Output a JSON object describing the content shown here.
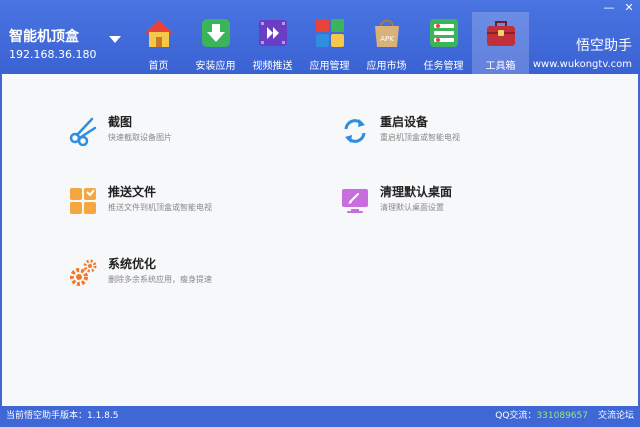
{
  "device": {
    "name": "智能机顶盒",
    "ip": "192.168.36.180"
  },
  "nav": [
    {
      "label": "首页",
      "icon": "home-icon"
    },
    {
      "label": "安装应用",
      "icon": "install-app-icon"
    },
    {
      "label": "视频推送",
      "icon": "video-push-icon"
    },
    {
      "label": "应用管理",
      "icon": "app-manage-icon"
    },
    {
      "label": "应用市场",
      "icon": "apk-market-icon"
    },
    {
      "label": "任务管理",
      "icon": "task-manage-icon"
    },
    {
      "label": "工具箱",
      "icon": "toolbox-icon",
      "active": true
    }
  ],
  "brand": {
    "name": "悟空助手",
    "url": "www.wukongtv.com"
  },
  "tools": [
    {
      "title": "截图",
      "desc": "快速截取设备图片",
      "icon": "scissors-icon"
    },
    {
      "title": "重启设备",
      "desc": "重启机顶盒或智能电视",
      "icon": "restart-icon"
    },
    {
      "title": "推送文件",
      "desc": "推送文件到机顶盒或智能电视",
      "icon": "push-file-icon"
    },
    {
      "title": "清理默认桌面",
      "desc": "清理默认桌面设置",
      "icon": "clean-desktop-icon"
    },
    {
      "title": "系统优化",
      "desc": "删除多余系统应用，瘦身提速",
      "icon": "gears-icon"
    }
  ],
  "status": {
    "version_label": "当前悟空助手版本：1.1.8.5",
    "qq_label": "QQ交流：",
    "qq_number": "331089657",
    "forum_label": "交流论坛"
  },
  "colors": {
    "brand_blue": "#3f67d6",
    "content_bg": "#f7f8fa",
    "qq_green": "#9ce67c"
  }
}
